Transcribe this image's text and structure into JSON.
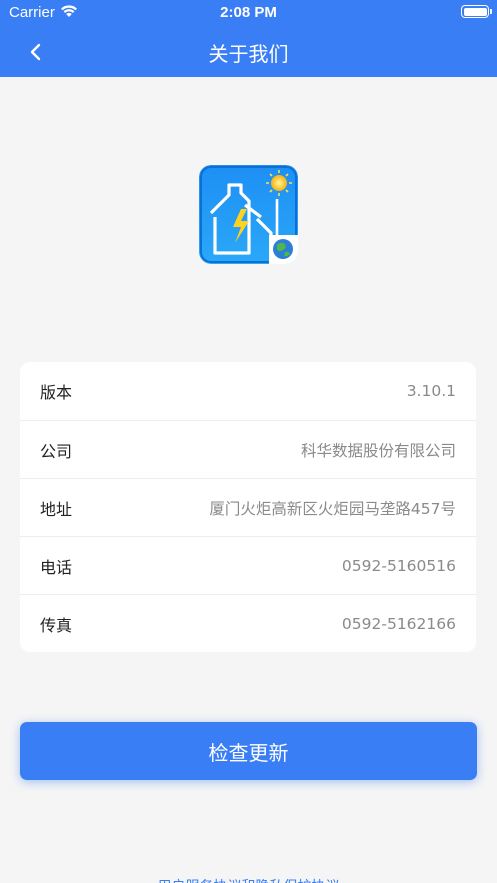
{
  "status_bar": {
    "carrier": "Carrier",
    "time": "2:08 PM"
  },
  "header": {
    "title": "关于我们"
  },
  "info": [
    {
      "label": "版本",
      "value": "3.10.1"
    },
    {
      "label": "公司",
      "value": "科华数据股份有限公司"
    },
    {
      "label": "地址",
      "value": "厦门火炬高新区火炬园马垄路457号"
    },
    {
      "label": "电话",
      "value": "0592-5160516"
    },
    {
      "label": "传真",
      "value": "0592-5162166"
    }
  ],
  "check_update_label": "检查更新",
  "footer": {
    "link_text": "用户服务协议和隐私保护协议"
  },
  "colors": {
    "primary": "#3a7ef5",
    "background": "#f5f5f5"
  }
}
